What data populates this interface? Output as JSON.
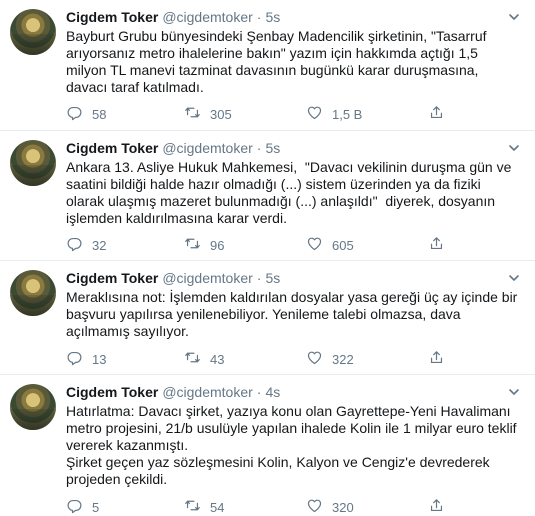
{
  "tweets": [
    {
      "name": "Cigdem Toker",
      "handle": "@cigdemtoker",
      "separator": "·",
      "time": "5s",
      "text": "Bayburt Grubu bünyesindeki Şenbay Madencilik şirketinin, \"Tasarruf arıyorsanız metro ihalelerine bakın\" yazım için hakkımda açtığı 1,5 milyon TL manevi tazminat davasının bugünkü karar duruşmasına, davacı taraf katılmadı.",
      "replies": "58",
      "retweets": "305",
      "likes": "1,5 B"
    },
    {
      "name": "Cigdem Toker",
      "handle": "@cigdemtoker",
      "separator": "·",
      "time": "5s",
      "text": "Ankara 13. Asliye Hukuk Mahkemesi,  \"Davacı vekilinin duruşma gün ve saatini bildiği halde hazır olmadığı (...) sistem üzerinden ya da fiziki olarak ulaşmış mazeret bulunmadığı (...) anlaşıldı\"  diyerek, dosyanın işlemden kaldırılmasına karar verdi.",
      "replies": "32",
      "retweets": "96",
      "likes": "605"
    },
    {
      "name": "Cigdem Toker",
      "handle": "@cigdemtoker",
      "separator": "·",
      "time": "5s",
      "text": "Meraklısına not: İşlemden kaldırılan dosyalar yasa gereği üç ay içinde bir başvuru yapılırsa yenilenebiliyor. Yenileme talebi olmazsa, dava açılmamış sayılıyor.",
      "replies": "13",
      "retweets": "43",
      "likes": "322"
    },
    {
      "name": "Cigdem Toker",
      "handle": "@cigdemtoker",
      "separator": "·",
      "time": "4s",
      "text": "Hatırlatma: Davacı şirket, yazıya konu olan Gayrettepe-Yeni Havalimanı metro projesini, 21/b usulüyle yapılan ihalede Kolin ile 1 milyar euro teklif vererek kazanmıştı.\nŞirket geçen yaz sözleşmesini Kolin, Kalyon ve Cengiz'e devrederek projeden çekildi.",
      "replies": "5",
      "retweets": "54",
      "likes": "320"
    }
  ],
  "icons": {
    "reply": "reply-icon",
    "retweet": "retweet-icon",
    "like": "heart-icon",
    "share": "share-icon",
    "caret": "chevron-down-icon"
  },
  "colors": {
    "text": "#14171a",
    "secondary": "#657786",
    "divider": "#e6ecf0"
  }
}
